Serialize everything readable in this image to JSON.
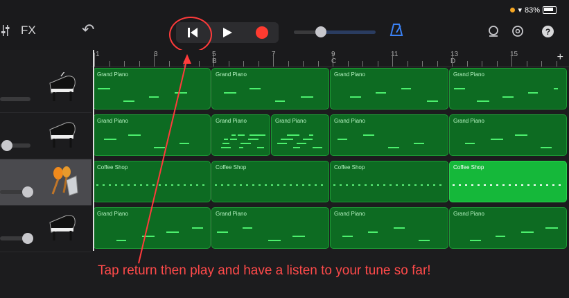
{
  "status": {
    "battery": "83%"
  },
  "toolbar": {
    "fx_label": "FX",
    "mixer_icon": "sliders-icon",
    "undo_icon": "undo-icon",
    "return_icon": "return-to-start-icon",
    "play_icon": "play-icon",
    "record_icon": "record-icon",
    "volume_level": 0.3,
    "metronome_icon": "metronome-icon",
    "loops_icon": "loop-icon",
    "settings_icon": "gear-icon",
    "help_label": "?"
  },
  "ruler": {
    "marks": [
      {
        "bar": "1",
        "section": ""
      },
      {
        "bar": "3",
        "section": ""
      },
      {
        "bar": "5",
        "section": "B"
      },
      {
        "bar": "7",
        "section": ""
      },
      {
        "bar": "9",
        "section": "C"
      },
      {
        "bar": "11",
        "section": ""
      },
      {
        "bar": "13",
        "section": "D"
      },
      {
        "bar": "15",
        "section": ""
      }
    ],
    "add_label": "+"
  },
  "tracks": [
    {
      "instrument": "grand-piano-icon",
      "regions": [
        "Grand Piano",
        "Grand Piano",
        "Grand Piano",
        "Grand Piano"
      ]
    },
    {
      "instrument": "grand-piano-icon",
      "regions": [
        "Grand Piano",
        "Grand Piano",
        "Grand Piano",
        "Grand Piano",
        "Grand Piano"
      ]
    },
    {
      "instrument": "maracas-icon",
      "regions": [
        "Coffee Shop",
        "Coffee Shop",
        "Coffee Shop",
        "Coffee Shop"
      ]
    },
    {
      "instrument": "grand-piano-icon",
      "regions": [
        "Grand Piano",
        "Grand Piano",
        "Grand Piano",
        "Grand Piano"
      ]
    }
  ],
  "annotation": {
    "text": "Tap return then play and have a listen to your tune so far!"
  },
  "colors": {
    "region": "#0d6b22",
    "region_selected": "#15b83a",
    "annotation": "#ff4a4a",
    "record": "#ff3b30"
  }
}
